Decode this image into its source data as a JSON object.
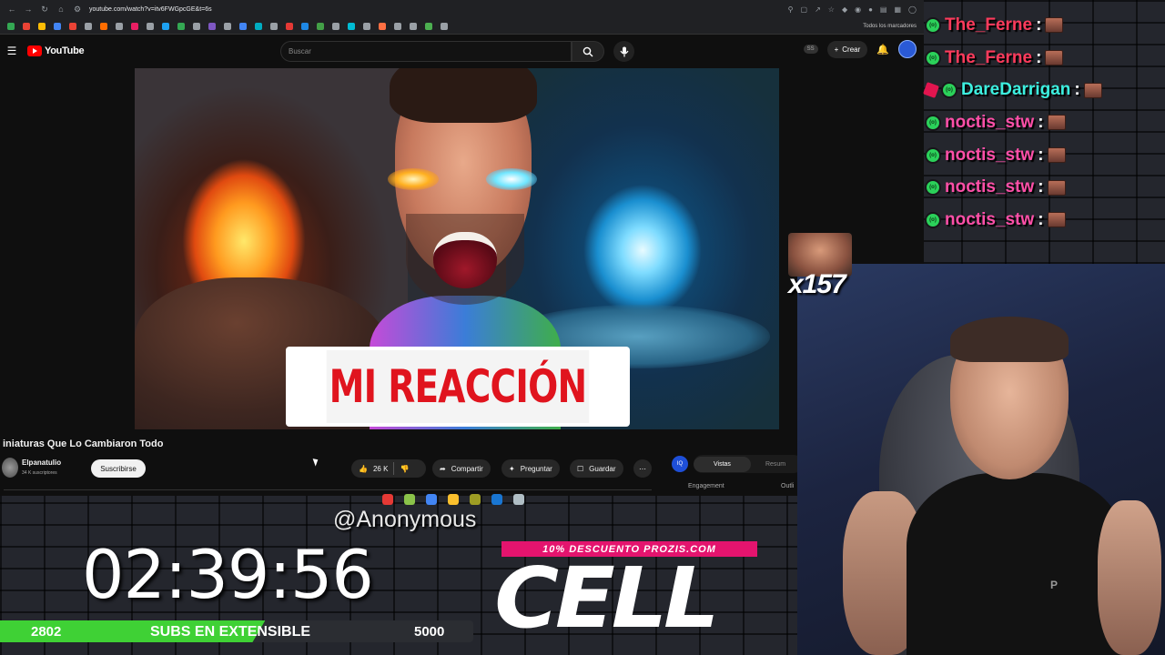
{
  "browser": {
    "url": "youtube.com/watch?v=itv6FWGpcGE&t=6s",
    "bookmarks_label": "Todos los marcadores",
    "bookmark_colors": [
      "#34a853",
      "#ea4335",
      "#fbbc05",
      "#4285f4",
      "#ea4335",
      "#9aa0a6",
      "#ff6d00",
      "#9aa0a6",
      "#e91e63",
      "#9aa0a6",
      "#1da1f2",
      "#34a853",
      "#9aa0a6",
      "#7e57c2",
      "#9aa0a6",
      "#4285f4",
      "#00acc1",
      "#9aa0a6",
      "#e53935",
      "#1e88e5",
      "#43a047",
      "#9aa0a6",
      "#00bcd4",
      "#9aa0a6",
      "#ff7043",
      "#9aa0a6",
      "#9aa0a6",
      "#4caf50",
      "#9aa0a6"
    ]
  },
  "youtube": {
    "logo_text": "YouTube",
    "search_placeholder": "Buscar",
    "ss_badge": "SS",
    "create_label": "Crear",
    "video_thumbnail_text": "MI REACCIÓN",
    "video_title": "iniaturas Que Lo Cambiaron Todo",
    "channel_name": "Elpanatulio",
    "channel_subs": "34 K suscriptores",
    "subscribe_label": "Suscribirse",
    "like_count": "26 K",
    "share_label": "Compartir",
    "ask_label": "Preguntar",
    "save_label": "Guardar",
    "panel_tab_views": "Vistas",
    "panel_tab_summary": "Resum",
    "panel_engagement": "Engagement",
    "panel_outlier": "Outli"
  },
  "taskbar_icons": [
    "#e53935",
    "#8bc34a",
    "#4285f4",
    "#fbc02d",
    "#9e9d24",
    "#1976d2",
    "#b0bec5"
  ],
  "overlay": {
    "donor": "@Anonymous",
    "timer": "02:39:56",
    "subs_current": "2802",
    "subs_label": "SUBS EN EXTENSIBLE",
    "subs_goal": "5000",
    "subs_progress": 0.5604,
    "promo_text": "10% DESCUENTO PROZIS.COM",
    "promo_code": "CELL",
    "emote_count": "x157"
  },
  "chat": [
    {
      "name": "The_Ferne",
      "color": "#ff3b5c",
      "badge": "green"
    },
    {
      "name": "The_Ferne",
      "color": "#ff3b5c",
      "badge": "green"
    },
    {
      "name": "DareDarrigan",
      "color": "#3df0e0",
      "badge": "pink"
    },
    {
      "name": "noctis_stw",
      "color": "#ff4fa8",
      "badge": "green"
    },
    {
      "name": "noctis_stw",
      "color": "#ff4fa8",
      "badge": "green"
    },
    {
      "name": "noctis_stw",
      "color": "#ff4fa8",
      "badge": "green"
    },
    {
      "name": "noctis_stw",
      "color": "#ff4fa8",
      "badge": "green"
    }
  ],
  "webcam": {
    "shirt_logo": "P"
  }
}
